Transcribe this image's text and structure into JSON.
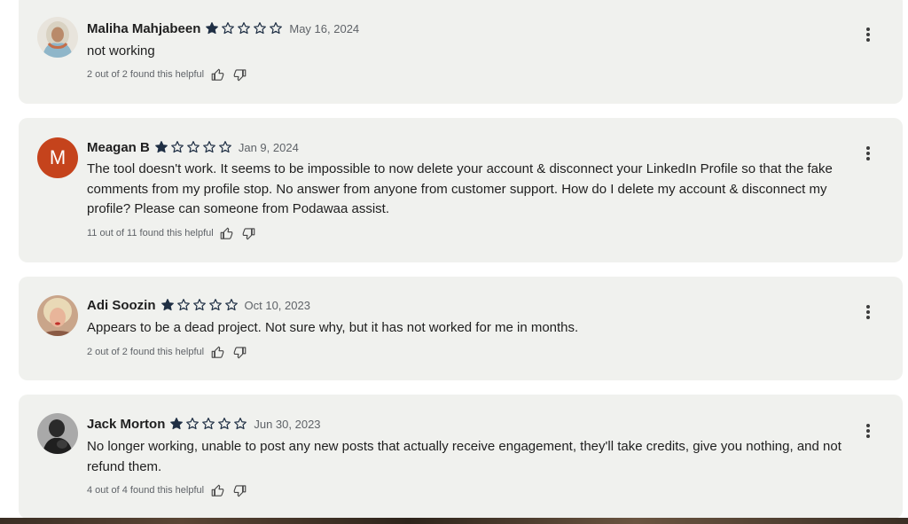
{
  "reviews": [
    {
      "name": "Maliha Mahjabeen",
      "date": "May 16, 2024",
      "rating": 1,
      "text": "not working",
      "helpful": "2 out of 2 found this helpful",
      "avatar": "photo"
    },
    {
      "name": "Meagan B",
      "date": "Jan 9, 2024",
      "rating": 1,
      "text": "The tool doesn't work. It seems to be impossible to now delete your account & disconnect your LinkedIn Profile so that the fake comments from my profile stop. No answer from anyone from customer support. How do I delete my account & disconnect my profile? Please can someone from Podawaa assist.",
      "helpful": "11 out of 11 found this helpful",
      "avatar_letter": "M"
    },
    {
      "name": "Adi Soozin",
      "date": "Oct 10, 2023",
      "rating": 1,
      "text": "Appears to be a dead project. Not sure why, but it has not worked for me in months.",
      "helpful": "2 out of 2 found this helpful",
      "avatar": "photo"
    },
    {
      "name": "Jack Morton",
      "date": "Jun 30, 2023",
      "rating": 1,
      "text": "No longer working, unable to post any new posts that actually receive engagement, they'll take credits, give you nothing, and not refund them.",
      "helpful": "4 out of 4 found this helpful",
      "avatar": "photo"
    }
  ],
  "icons": {
    "star_filled": "star-filled-icon",
    "star_empty": "star-outline-icon",
    "thumbs_up": "thumbs-up-icon",
    "thumbs_down": "thumbs-down-icon",
    "more": "more-vert-icon"
  },
  "colors": {
    "card_bg": "#f0f1ee",
    "star": "#1f2f44",
    "avatar_letter_bg": "#c5431c",
    "meta_text": "#5f6368"
  }
}
